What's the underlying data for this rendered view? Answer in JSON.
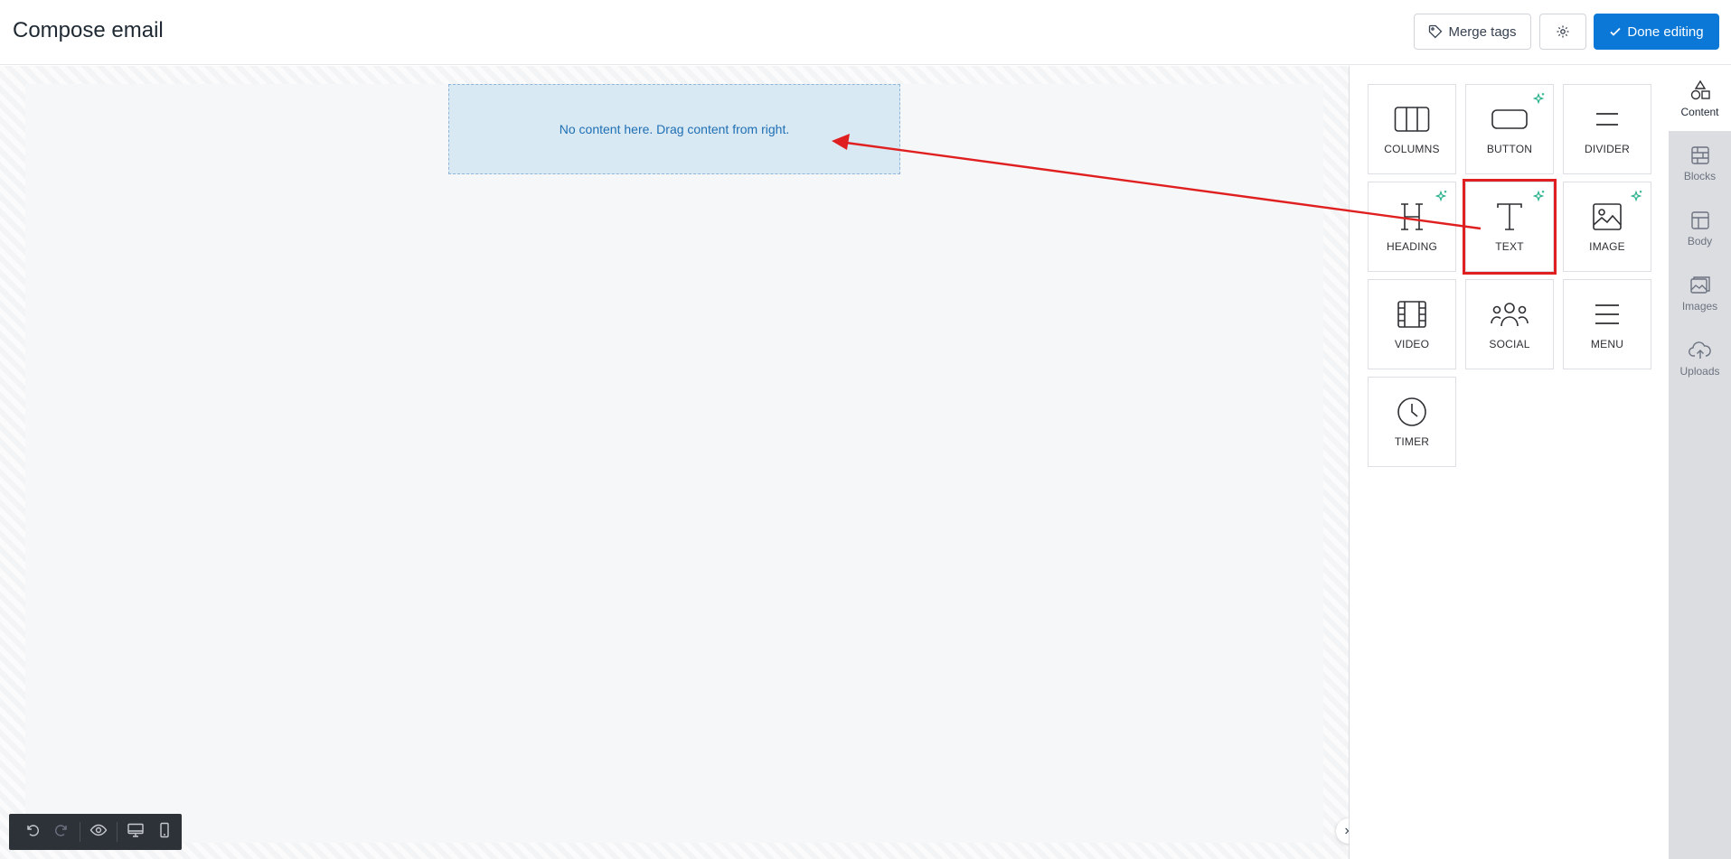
{
  "header": {
    "title": "Compose email",
    "merge_tags_label": "Merge tags",
    "done_label": "Done editing"
  },
  "canvas": {
    "placeholder": "No content here. Drag content from right."
  },
  "content_tiles": [
    {
      "label": "COLUMNS",
      "icon": "columns-icon",
      "ai": false
    },
    {
      "label": "BUTTON",
      "icon": "button-icon",
      "ai": true
    },
    {
      "label": "DIVIDER",
      "icon": "divider-icon",
      "ai": false
    },
    {
      "label": "HEADING",
      "icon": "heading-icon",
      "ai": true
    },
    {
      "label": "TEXT",
      "icon": "text-icon",
      "ai": true,
      "highlighted": true
    },
    {
      "label": "IMAGE",
      "icon": "image-icon",
      "ai": true
    },
    {
      "label": "VIDEO",
      "icon": "video-icon",
      "ai": false
    },
    {
      "label": "SOCIAL",
      "icon": "social-icon",
      "ai": false
    },
    {
      "label": "MENU",
      "icon": "menu-icon",
      "ai": false
    },
    {
      "label": "TIMER",
      "icon": "timer-icon",
      "ai": false
    }
  ],
  "sidenav": {
    "items": [
      {
        "label": "Content",
        "icon": "shapes-icon",
        "active": true
      },
      {
        "label": "Blocks",
        "icon": "blocks-icon",
        "active": false
      },
      {
        "label": "Body",
        "icon": "body-layout-icon",
        "active": false
      },
      {
        "label": "Images",
        "icon": "images-icon",
        "active": false
      },
      {
        "label": "Uploads",
        "icon": "upload-cloud-icon",
        "active": false
      }
    ]
  },
  "colors": {
    "primary": "#0b78d8",
    "dropzone_bg": "#d9e9f3",
    "annotation": "#e02020",
    "ai_sparkle": "#25b08a"
  }
}
